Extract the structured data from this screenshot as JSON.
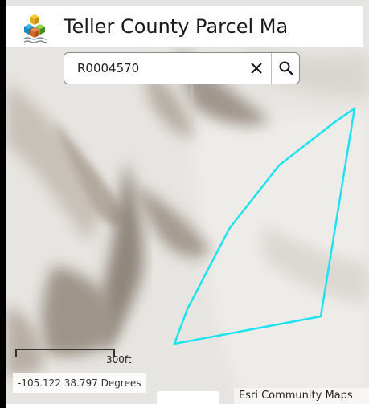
{
  "app": {
    "title": "Teller County Parcel Ma",
    "logo_icon": "stacked-cubes-logo-icon"
  },
  "search": {
    "value": "R0004570",
    "clear_icon": "close-icon",
    "search_icon": "search-icon"
  },
  "map": {
    "scale_label": "300ft",
    "coordinates": "-105.122 38.797 Degrees",
    "attribution": "Esri Community Maps",
    "parcel_outline_color": "#1ee3ee"
  }
}
